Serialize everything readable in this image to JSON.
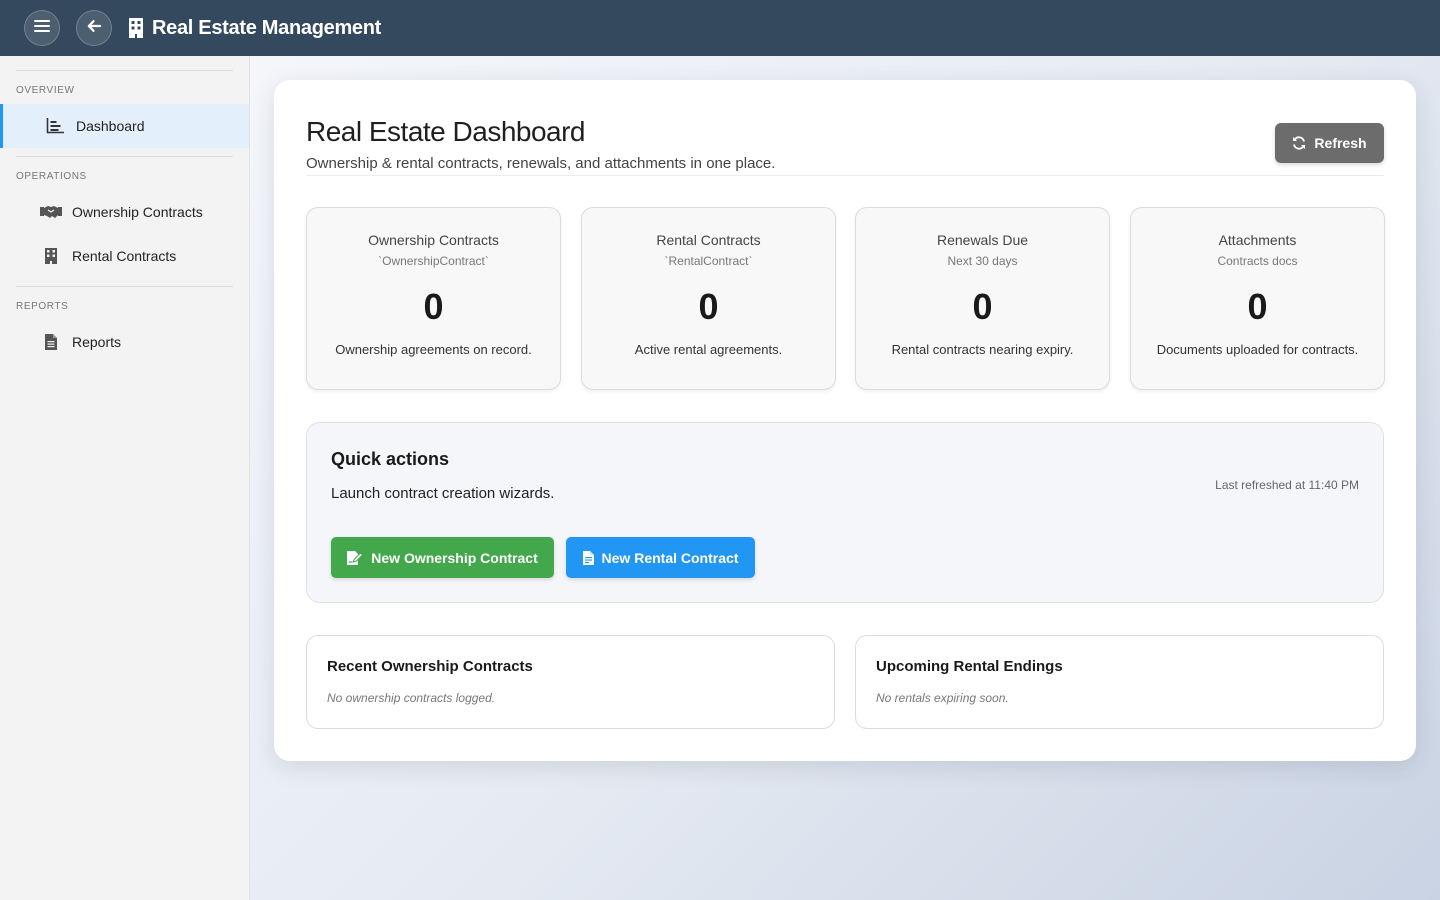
{
  "topbar": {
    "title": "Real Estate Management",
    "menu_icon": "hamburger-menu-icon",
    "back_icon": "arrow-left-icon",
    "app_icon": "building-icon",
    "background": "#34495e"
  },
  "sidebar": {
    "sections": [
      {
        "label": "OVERVIEW",
        "items": [
          {
            "label": "Dashboard",
            "icon": "bar-chart-icon",
            "active": true
          }
        ]
      },
      {
        "label": "OPERATIONS",
        "items": [
          {
            "label": "Ownership Contracts",
            "icon": "handshake-icon",
            "active": false
          },
          {
            "label": "Rental Contracts",
            "icon": "building-icon",
            "active": false
          }
        ]
      },
      {
        "label": "REPORTS",
        "items": [
          {
            "label": "Reports",
            "icon": "file-icon",
            "active": false
          }
        ]
      }
    ]
  },
  "header": {
    "title": "Real Estate Dashboard",
    "subtitle": "Ownership & rental contracts, renewals, and attachments in one place.",
    "refresh_label": "Refresh"
  },
  "stats": [
    {
      "title": "Ownership Contracts",
      "sub": "`OwnershipContract`",
      "value": "0",
      "desc": "Ownership agreements on record."
    },
    {
      "title": "Rental Contracts",
      "sub": "`RentalContract`",
      "value": "0",
      "desc": "Active rental agreements."
    },
    {
      "title": "Renewals Due",
      "sub": "Next 30 days",
      "value": "0",
      "desc": "Rental contracts nearing expiry."
    },
    {
      "title": "Attachments",
      "sub": "Contracts docs",
      "value": "0",
      "desc": "Documents uploaded for contracts."
    }
  ],
  "quick_actions": {
    "title": "Quick actions",
    "subtitle": "Launch contract creation wizards.",
    "last_refreshed": "Last refreshed at 11:40 PM",
    "new_ownership_label": "New Ownership Contract",
    "new_rental_label": "New Rental Contract",
    "green": "#43a84b",
    "blue": "#2196f3"
  },
  "panels": {
    "recent_ownership": {
      "title": "Recent Ownership Contracts",
      "empty": "No ownership contracts logged."
    },
    "upcoming_rental": {
      "title": "Upcoming Rental Endings",
      "empty": "No rentals expiring soon."
    }
  }
}
